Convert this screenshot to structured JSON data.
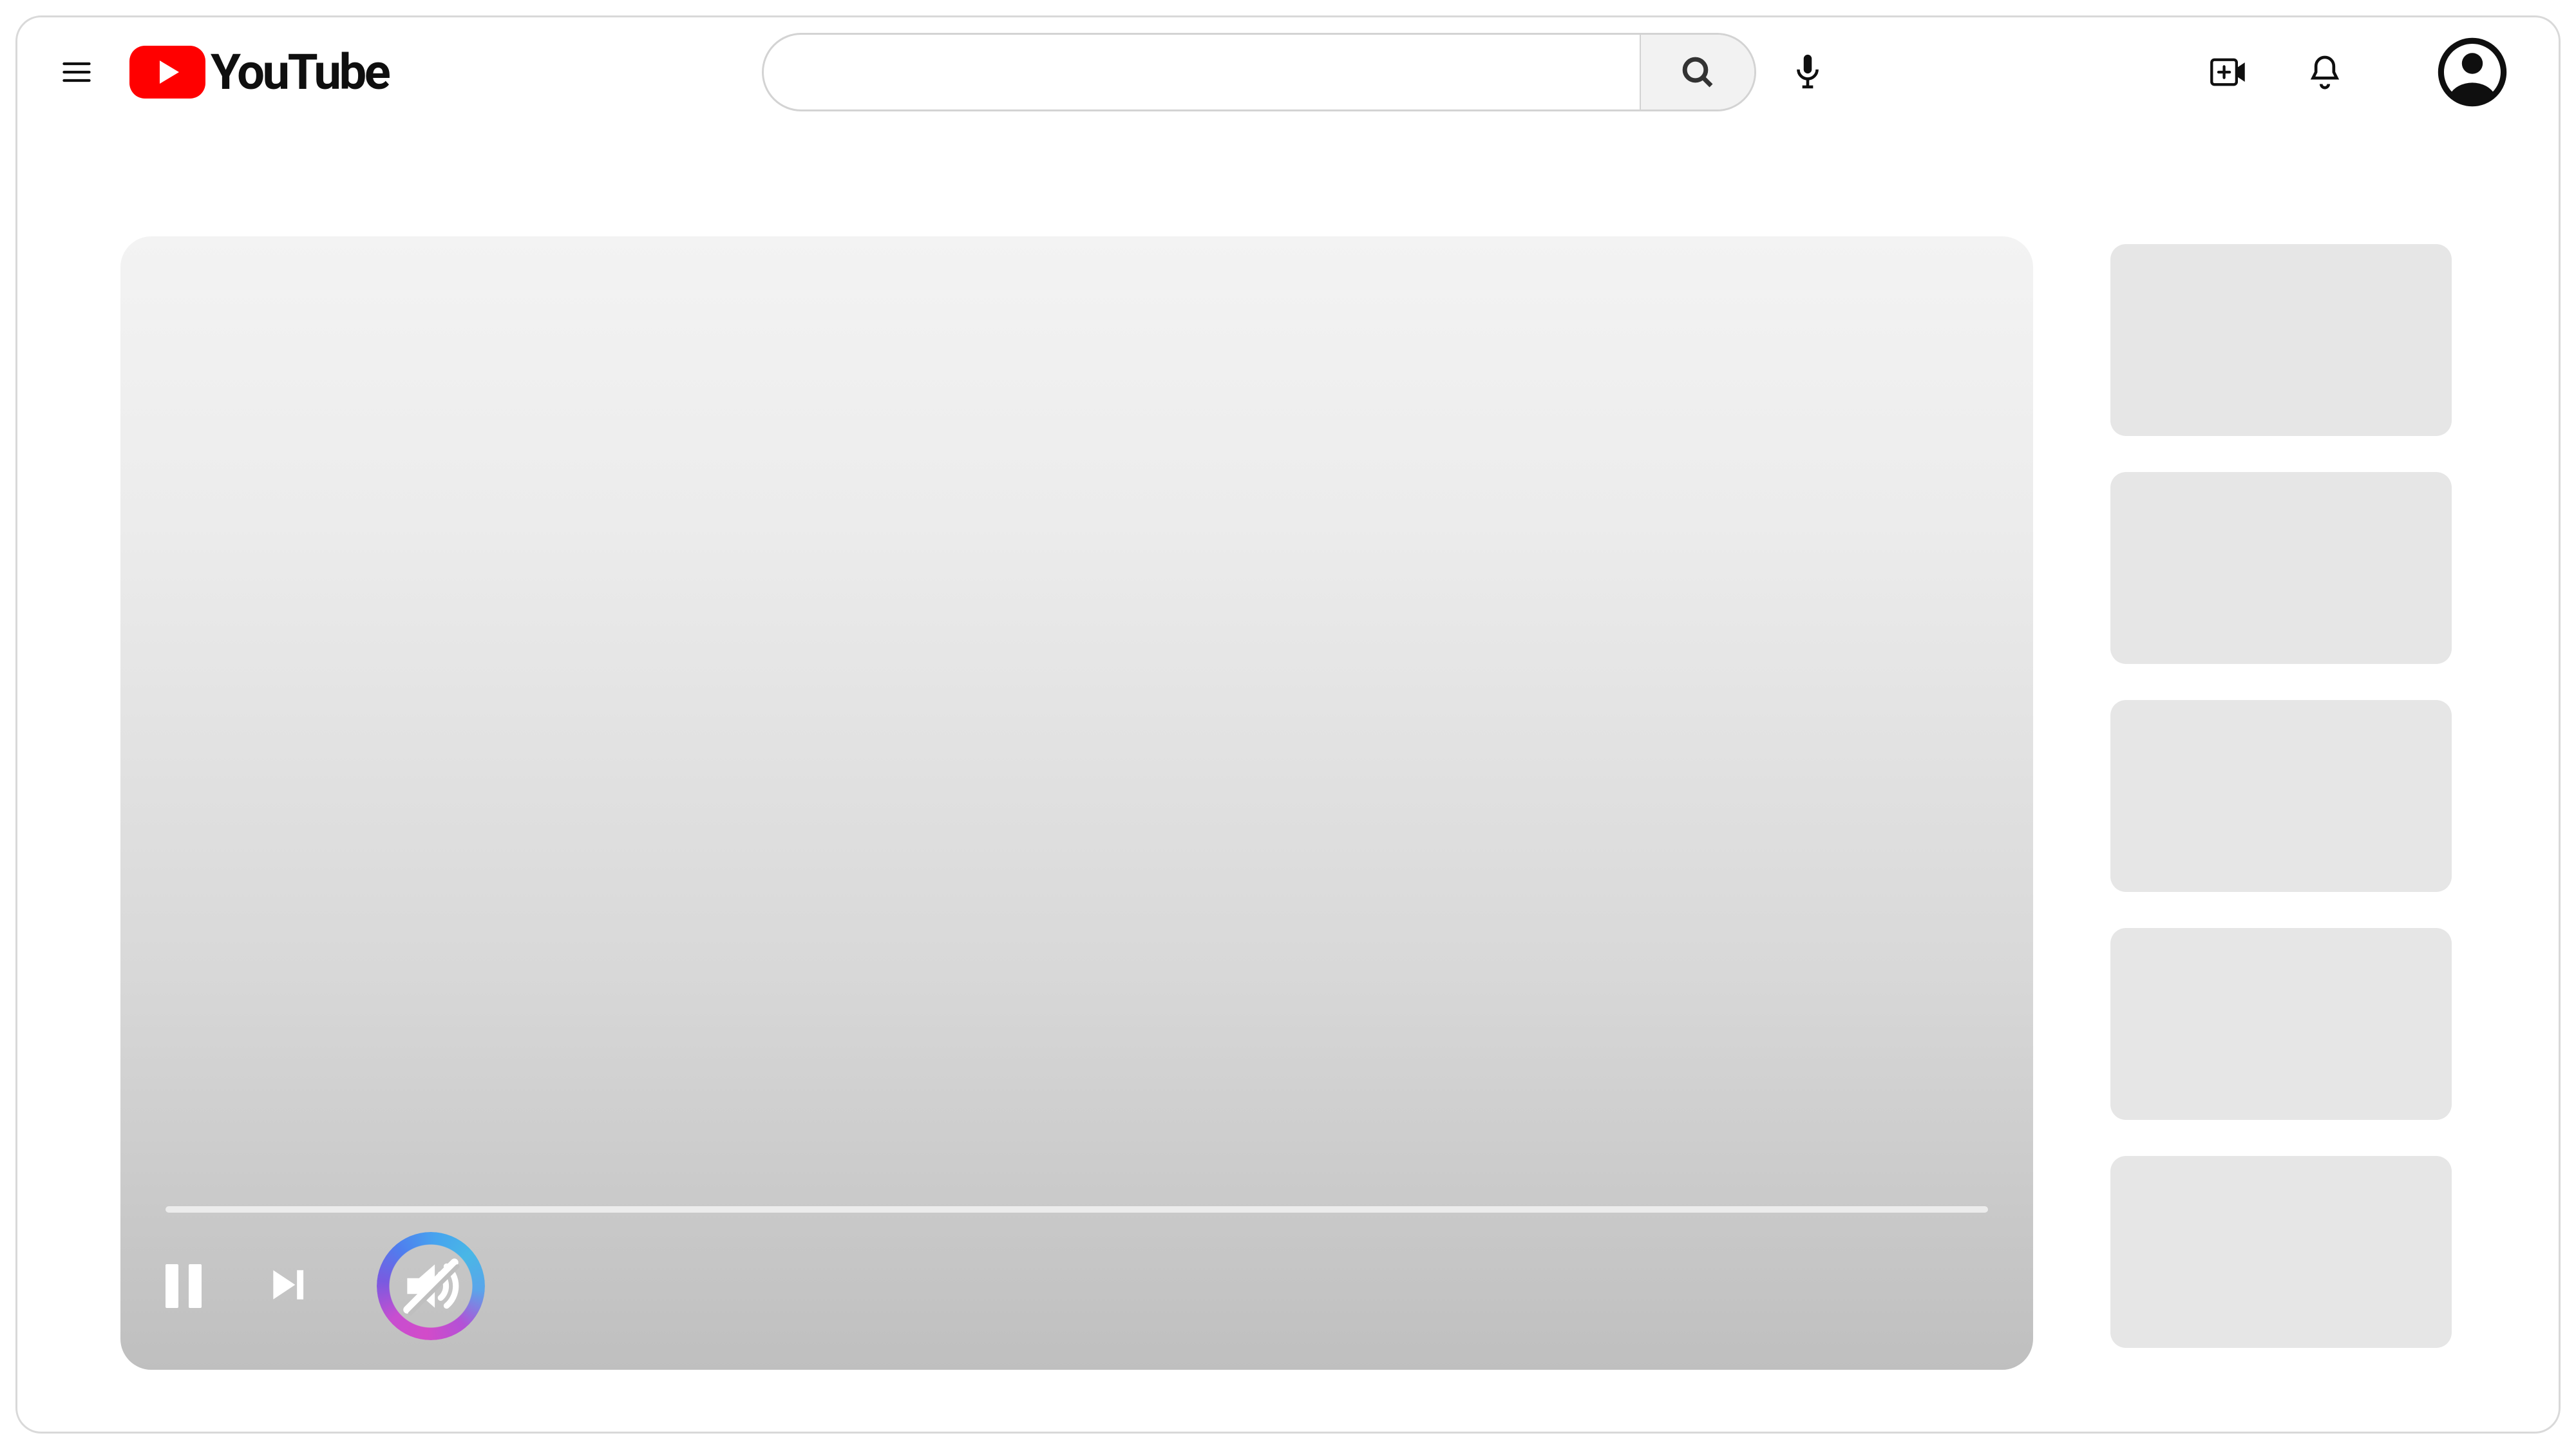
{
  "brand": {
    "name": "YouTube"
  },
  "search": {
    "placeholder": "",
    "value": ""
  },
  "player": {
    "is_playing": true,
    "is_muted": true,
    "progress_percent": 0,
    "highlighted_control": "mute"
  },
  "sidebar": {
    "thumbnail_count": 5
  },
  "icons": {
    "menu": "hamburger-icon",
    "search": "search-icon",
    "mic": "microphone-icon",
    "create": "create-video-icon",
    "notifications": "bell-icon",
    "avatar": "account-avatar-icon",
    "pause": "pause-icon",
    "next": "next-track-icon",
    "mute": "volume-muted-icon"
  }
}
